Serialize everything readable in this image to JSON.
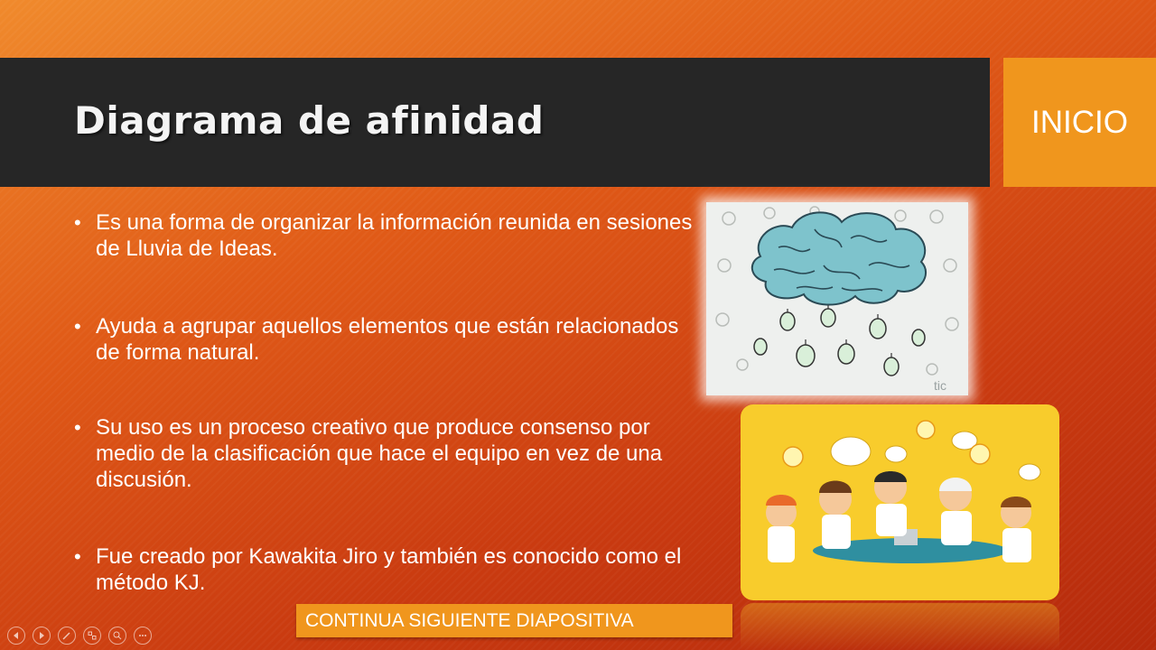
{
  "slide": {
    "title": "Diagrama de afinidad",
    "inicio_label": "INICIO",
    "bullets": [
      "Es una forma de organizar la información reunida en sesiones de Lluvia de Ideas.",
      "Ayuda a agrupar aquellos elementos que están relacionados de forma natural.",
      "Su uso es un proceso creativo que produce consenso por medio de la clasificación que hace el equipo en vez de una discusión.",
      "Fue creado por Kawakita Jiro y también es conocido como el método KJ."
    ],
    "continue_label": "CONTINUA SIGUIENTE DIAPOSITIVA",
    "brain_watermark": "tic"
  },
  "colors": {
    "title_bar": "#262626",
    "accent": "#f0961d",
    "background_top": "#f08a2c",
    "background_bottom": "#b52a0c",
    "meeting_bg": "#f8cc2c"
  },
  "nav": {
    "icons": [
      "previous-icon",
      "next-icon",
      "pen-icon",
      "slides-grid-icon",
      "zoom-icon",
      "more-icon"
    ]
  }
}
